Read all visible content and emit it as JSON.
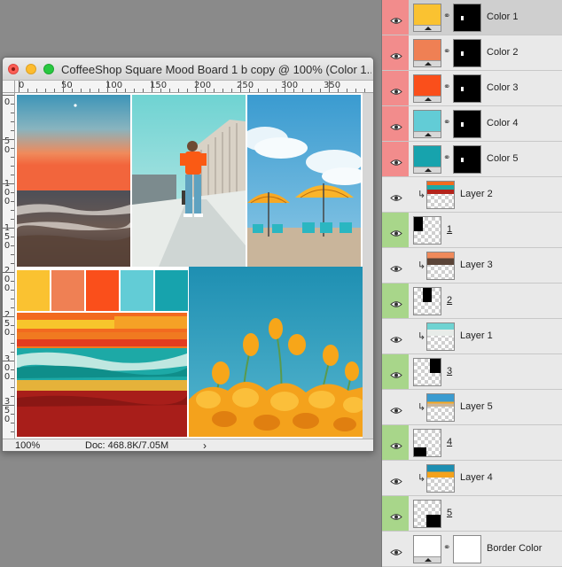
{
  "window": {
    "title": "CoffeeShop Square Mood Board 1 b copy @ 100% (Color 1...",
    "ruler_h_labels": [
      "0",
      "50",
      "100",
      "150",
      "200",
      "250",
      "300",
      "350"
    ],
    "ruler_v_labels": [
      "0",
      "5 0",
      "1 0 0",
      "1 5 0",
      "2 0 0",
      "2 5 0",
      "3 0 0",
      "3 5 0"
    ],
    "status": {
      "zoom": "100%",
      "doc": "Doc: 468.8K/7.05M",
      "arrow": "›"
    }
  },
  "moodboard": {
    "tiles": [
      {
        "name": "sunset-beach-photo"
      },
      {
        "name": "woman-orange-shirt-photo"
      },
      {
        "name": "beach-umbrellas-photo"
      },
      {
        "name": "abstract-paint-photo"
      },
      {
        "name": "poppy-flowers-photo"
      }
    ],
    "swatches": [
      "#fac231",
      "#ef8054",
      "#fa4f1b",
      "#62ccd6",
      "#17a3ad"
    ]
  },
  "layers": [
    {
      "name": "Color 1",
      "kind": "fill",
      "color": "#fac231",
      "visible": true,
      "eye_bg": "#f28c8c",
      "selected": true
    },
    {
      "name": "Color 2",
      "kind": "fill",
      "color": "#ef8054",
      "visible": true,
      "eye_bg": "#f28c8c",
      "selected": false
    },
    {
      "name": "Color 3",
      "kind": "fill",
      "color": "#fa4f1b",
      "visible": true,
      "eye_bg": "#f28c8c",
      "selected": false
    },
    {
      "name": "Color 4",
      "kind": "fill",
      "color": "#62ccd6",
      "visible": true,
      "eye_bg": "#f28c8c",
      "selected": false
    },
    {
      "name": "Color 5",
      "kind": "fill",
      "color": "#17a3ad",
      "visible": true,
      "eye_bg": "#f28c8c",
      "selected": false
    },
    {
      "name": "Layer 2",
      "kind": "clip",
      "visible": true,
      "eye_bg": "#e9e9e9"
    },
    {
      "name": "1",
      "kind": "shape",
      "visible": true,
      "eye_bg": "#a8d68a",
      "shape": "tl"
    },
    {
      "name": "Layer 3",
      "kind": "clip",
      "visible": true,
      "eye_bg": "#e9e9e9"
    },
    {
      "name": "2",
      "kind": "shape",
      "visible": true,
      "eye_bg": "#a8d68a",
      "shape": "tc"
    },
    {
      "name": "Layer 1",
      "kind": "clip",
      "visible": true,
      "eye_bg": "#e9e9e9"
    },
    {
      "name": "3",
      "kind": "shape",
      "visible": true,
      "eye_bg": "#a8d68a",
      "shape": "tr"
    },
    {
      "name": "Layer 5",
      "kind": "clip",
      "visible": true,
      "eye_bg": "#e9e9e9"
    },
    {
      "name": "4",
      "kind": "shape",
      "visible": true,
      "eye_bg": "#a8d68a",
      "shape": "bl"
    },
    {
      "name": "Layer 4",
      "kind": "clip",
      "visible": true,
      "eye_bg": "#e9e9e9"
    },
    {
      "name": "5",
      "kind": "shape",
      "visible": true,
      "eye_bg": "#a8d68a",
      "shape": "br"
    },
    {
      "name": "Border Color",
      "kind": "fill",
      "color": "#ffffff",
      "visible": true,
      "eye_bg": "#e9e9e9",
      "selected": false
    }
  ]
}
